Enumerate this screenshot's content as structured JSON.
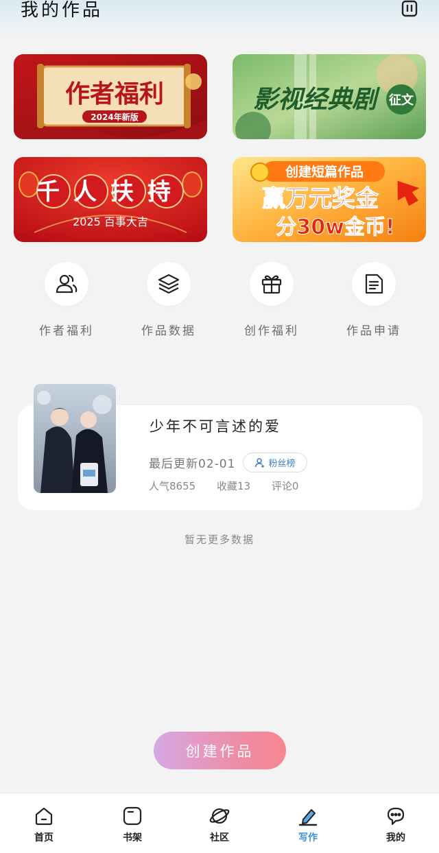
{
  "header": {
    "title": "我的作品",
    "right_icon": "trash-icon"
  },
  "banners": [
    {
      "name": "author-welfare",
      "title": "作者福利",
      "subtitle": "2024年新版",
      "colors": [
        "#a71418",
        "#f6e3b8"
      ]
    },
    {
      "name": "film-tv-classic",
      "title": "影视经典剧",
      "badge": "征文",
      "colors": [
        "#3f8f4a",
        "#cfe6a2"
      ]
    },
    {
      "name": "thousand-support",
      "title": "千人扶持",
      "subtitle": "2025 百事大吉",
      "colors": [
        "#c8141c",
        "#ffd2a4"
      ]
    },
    {
      "name": "short-story-contest",
      "line1": "创建短篇作品",
      "line2": "赢万元奖金",
      "line3": "分30w金币!",
      "colors": [
        "#f07a10",
        "#ffe9a8"
      ]
    }
  ],
  "quick_actions": [
    {
      "label": "作者福利",
      "icon": "users-icon"
    },
    {
      "label": "作品数据",
      "icon": "layers-icon"
    },
    {
      "label": "创作福利",
      "icon": "gift-icon"
    },
    {
      "label": "作品申请",
      "icon": "document-icon"
    }
  ],
  "work": {
    "title": "少年不可言述的爱",
    "last_update": "最后更新02-01",
    "fans_button": "粉丝榜",
    "popularity": "人气8655",
    "favorites": "收藏13",
    "comments": "评论0"
  },
  "no_more_text": "暂无更多数据",
  "create_button": "创建作品",
  "tabs": [
    {
      "label": "首页",
      "icon": "home-icon",
      "active": false
    },
    {
      "label": "书架",
      "icon": "bookshelf-icon",
      "active": false
    },
    {
      "label": "社区",
      "icon": "planet-icon",
      "active": false
    },
    {
      "label": "写作",
      "icon": "pen-icon",
      "active": true
    },
    {
      "label": "我的",
      "icon": "chat-bubble-icon",
      "active": false
    }
  ],
  "colors": {
    "accent": "#3a90d9",
    "background": "#f3f3f4",
    "create_gradient_start": "#d6a8e4",
    "create_gradient_end": "#f6878f"
  }
}
